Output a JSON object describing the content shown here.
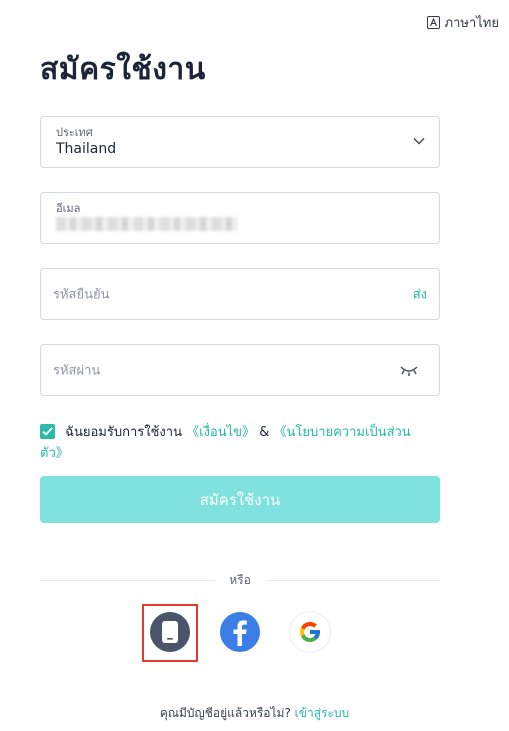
{
  "language": {
    "label": "ภาษาไทย",
    "icon": "translate-icon"
  },
  "title": "สมัครใช้งาน",
  "form": {
    "country": {
      "label": "ประเทศ",
      "value": "Thailand"
    },
    "email": {
      "label": "อีเมล",
      "value_state": "blurred"
    },
    "code": {
      "placeholder": "รหัสยืนยัน",
      "send_label": "ส่ง"
    },
    "password": {
      "placeholder": "รหัสผ่าน",
      "icon": "eye-closed-icon"
    },
    "agreement": {
      "text": "ฉันยอมรับการใช้งาน",
      "terms_link": "《เงื่อนไข》",
      "and": "&",
      "privacy_link_part1": "《นโยบายความเป็นส่วน",
      "privacy_link_part2": "ตัว》",
      "checked": true
    },
    "submit_label": "สมัครใช้งาน"
  },
  "divider": {
    "or_label": "หรือ"
  },
  "social": [
    {
      "name": "phone",
      "icon": "phone-icon"
    },
    {
      "name": "facebook",
      "icon": "facebook-icon"
    },
    {
      "name": "google",
      "icon": "google-icon"
    }
  ],
  "footer": {
    "question": "คุณมีบัญชีอยู่แล้วหรือไม่?",
    "login_link": "เข้าสู่ระบบ"
  },
  "colors": {
    "accent": "#26b8a9",
    "button_disabled": "#7fe2df",
    "highlight": "#e53b2f",
    "facebook": "#3b7ee8",
    "phone": "#4a5567"
  }
}
